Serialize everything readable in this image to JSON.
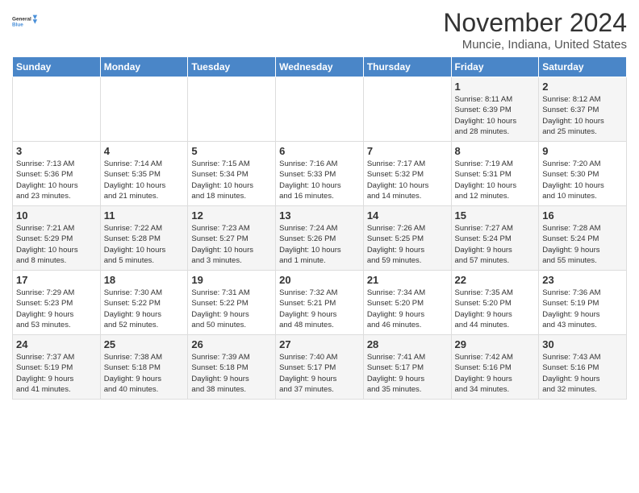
{
  "logo": {
    "line1": "General",
    "line2": "Blue"
  },
  "title": "November 2024",
  "location": "Muncie, Indiana, United States",
  "headers": [
    "Sunday",
    "Monday",
    "Tuesday",
    "Wednesday",
    "Thursday",
    "Friday",
    "Saturday"
  ],
  "weeks": [
    [
      {
        "day": "",
        "info": ""
      },
      {
        "day": "",
        "info": ""
      },
      {
        "day": "",
        "info": ""
      },
      {
        "day": "",
        "info": ""
      },
      {
        "day": "",
        "info": ""
      },
      {
        "day": "1",
        "info": "Sunrise: 8:11 AM\nSunset: 6:39 PM\nDaylight: 10 hours\nand 28 minutes."
      },
      {
        "day": "2",
        "info": "Sunrise: 8:12 AM\nSunset: 6:37 PM\nDaylight: 10 hours\nand 25 minutes."
      }
    ],
    [
      {
        "day": "3",
        "info": "Sunrise: 7:13 AM\nSunset: 5:36 PM\nDaylight: 10 hours\nand 23 minutes."
      },
      {
        "day": "4",
        "info": "Sunrise: 7:14 AM\nSunset: 5:35 PM\nDaylight: 10 hours\nand 21 minutes."
      },
      {
        "day": "5",
        "info": "Sunrise: 7:15 AM\nSunset: 5:34 PM\nDaylight: 10 hours\nand 18 minutes."
      },
      {
        "day": "6",
        "info": "Sunrise: 7:16 AM\nSunset: 5:33 PM\nDaylight: 10 hours\nand 16 minutes."
      },
      {
        "day": "7",
        "info": "Sunrise: 7:17 AM\nSunset: 5:32 PM\nDaylight: 10 hours\nand 14 minutes."
      },
      {
        "day": "8",
        "info": "Sunrise: 7:19 AM\nSunset: 5:31 PM\nDaylight: 10 hours\nand 12 minutes."
      },
      {
        "day": "9",
        "info": "Sunrise: 7:20 AM\nSunset: 5:30 PM\nDaylight: 10 hours\nand 10 minutes."
      }
    ],
    [
      {
        "day": "10",
        "info": "Sunrise: 7:21 AM\nSunset: 5:29 PM\nDaylight: 10 hours\nand 8 minutes."
      },
      {
        "day": "11",
        "info": "Sunrise: 7:22 AM\nSunset: 5:28 PM\nDaylight: 10 hours\nand 5 minutes."
      },
      {
        "day": "12",
        "info": "Sunrise: 7:23 AM\nSunset: 5:27 PM\nDaylight: 10 hours\nand 3 minutes."
      },
      {
        "day": "13",
        "info": "Sunrise: 7:24 AM\nSunset: 5:26 PM\nDaylight: 10 hours\nand 1 minute."
      },
      {
        "day": "14",
        "info": "Sunrise: 7:26 AM\nSunset: 5:25 PM\nDaylight: 9 hours\nand 59 minutes."
      },
      {
        "day": "15",
        "info": "Sunrise: 7:27 AM\nSunset: 5:24 PM\nDaylight: 9 hours\nand 57 minutes."
      },
      {
        "day": "16",
        "info": "Sunrise: 7:28 AM\nSunset: 5:24 PM\nDaylight: 9 hours\nand 55 minutes."
      }
    ],
    [
      {
        "day": "17",
        "info": "Sunrise: 7:29 AM\nSunset: 5:23 PM\nDaylight: 9 hours\nand 53 minutes."
      },
      {
        "day": "18",
        "info": "Sunrise: 7:30 AM\nSunset: 5:22 PM\nDaylight: 9 hours\nand 52 minutes."
      },
      {
        "day": "19",
        "info": "Sunrise: 7:31 AM\nSunset: 5:22 PM\nDaylight: 9 hours\nand 50 minutes."
      },
      {
        "day": "20",
        "info": "Sunrise: 7:32 AM\nSunset: 5:21 PM\nDaylight: 9 hours\nand 48 minutes."
      },
      {
        "day": "21",
        "info": "Sunrise: 7:34 AM\nSunset: 5:20 PM\nDaylight: 9 hours\nand 46 minutes."
      },
      {
        "day": "22",
        "info": "Sunrise: 7:35 AM\nSunset: 5:20 PM\nDaylight: 9 hours\nand 44 minutes."
      },
      {
        "day": "23",
        "info": "Sunrise: 7:36 AM\nSunset: 5:19 PM\nDaylight: 9 hours\nand 43 minutes."
      }
    ],
    [
      {
        "day": "24",
        "info": "Sunrise: 7:37 AM\nSunset: 5:19 PM\nDaylight: 9 hours\nand 41 minutes."
      },
      {
        "day": "25",
        "info": "Sunrise: 7:38 AM\nSunset: 5:18 PM\nDaylight: 9 hours\nand 40 minutes."
      },
      {
        "day": "26",
        "info": "Sunrise: 7:39 AM\nSunset: 5:18 PM\nDaylight: 9 hours\nand 38 minutes."
      },
      {
        "day": "27",
        "info": "Sunrise: 7:40 AM\nSunset: 5:17 PM\nDaylight: 9 hours\nand 37 minutes."
      },
      {
        "day": "28",
        "info": "Sunrise: 7:41 AM\nSunset: 5:17 PM\nDaylight: 9 hours\nand 35 minutes."
      },
      {
        "day": "29",
        "info": "Sunrise: 7:42 AM\nSunset: 5:16 PM\nDaylight: 9 hours\nand 34 minutes."
      },
      {
        "day": "30",
        "info": "Sunrise: 7:43 AM\nSunset: 5:16 PM\nDaylight: 9 hours\nand 32 minutes."
      }
    ]
  ]
}
